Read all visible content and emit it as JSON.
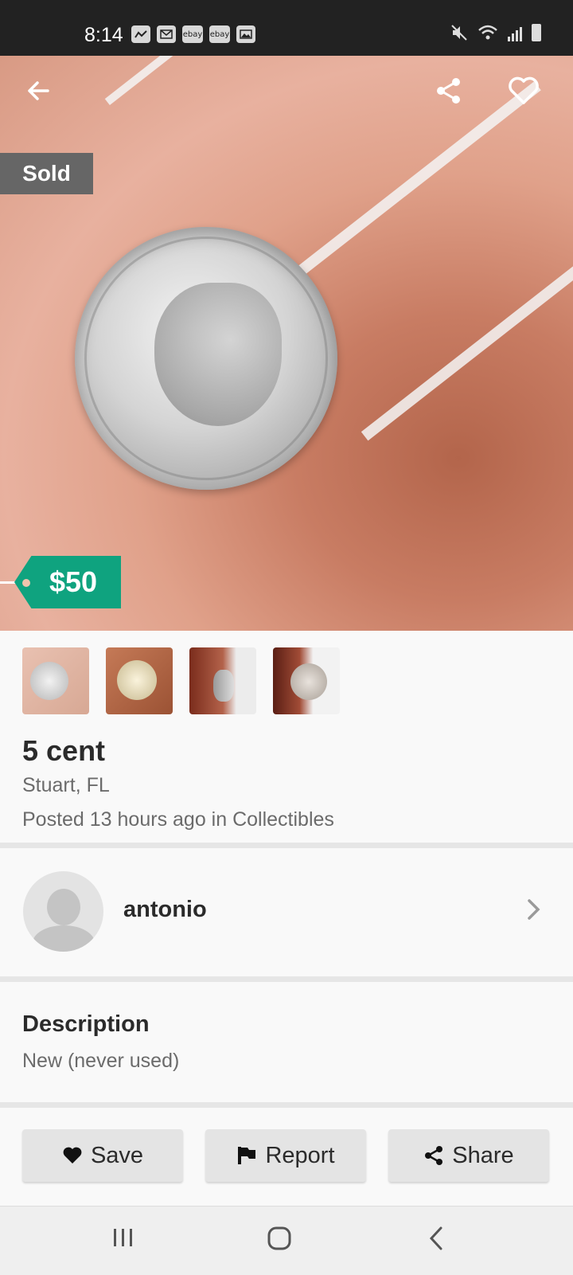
{
  "status_bar": {
    "time": "8:14",
    "notification_icons": [
      "activity-icon",
      "gmail-icon",
      "ebay-icon",
      "ebay-icon",
      "image-icon"
    ],
    "ebay_label": "ebay",
    "right_icons": [
      "mute-icon",
      "wifi-icon",
      "signal-icon",
      "battery-icon"
    ]
  },
  "listing": {
    "sold_label": "Sold",
    "price": "$50",
    "title": "5 cent",
    "location": "Stuart, FL",
    "posted": "Posted 13 hours ago in Collectibles",
    "thumbnail_count": 4
  },
  "seller": {
    "name": "antonio"
  },
  "description": {
    "heading": "Description",
    "text": "New (never used)"
  },
  "actions": {
    "save": "Save",
    "report": "Report",
    "share": "Share"
  },
  "colors": {
    "accent": "#0fa37f",
    "sold_badge": "#666666",
    "status_bar": "#222222"
  }
}
